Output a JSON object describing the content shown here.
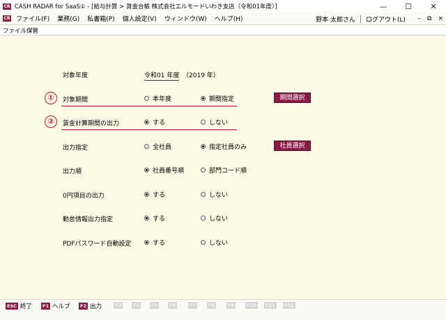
{
  "window": {
    "logo_text": "CR",
    "title": "CASH RADAR for SaaS① - [給与計算 > 賃金台帳 株式会社エルモードいわき支店（令和01年度）]",
    "controls": {
      "minimize": "—",
      "maximize": "☐",
      "close": "✕"
    }
  },
  "menubar": {
    "logo_text": "CR",
    "items": [
      "ファイル(F)",
      "業務(G)",
      "私書箱(P)",
      "個人設定(V)",
      "ウィンドウ(W)",
      "ヘルプ(H)"
    ],
    "user": "野本 太郎さん",
    "logout": "ログアウト(L)",
    "mdi": {
      "minimize": "–",
      "restore": "⧉",
      "close": "×"
    }
  },
  "page": {
    "title": "ファイル保管"
  },
  "form": {
    "target_year": {
      "label": "対象年度",
      "value": "令和01 年度",
      "paren": "（2019 年）"
    },
    "target_period": {
      "marker": "①",
      "label": "対象期間",
      "opt1": "本年度",
      "opt2": "期間指定",
      "selected": 2,
      "button": "期間選択"
    },
    "wage_period": {
      "marker": "②",
      "label": "賃金計算期間の出力",
      "opt1": "する",
      "opt2": "しない",
      "selected": 1
    },
    "output_target": {
      "label": "出力指定",
      "opt1": "全社員",
      "opt2": "指定社員のみ",
      "selected": 2,
      "button": "社員選択"
    },
    "output_order": {
      "label": "出力順",
      "opt1": "社員番号順",
      "opt2": "部門コード順",
      "selected": 1
    },
    "zero_items": {
      "label": "0円項目の出力",
      "opt1": "する",
      "opt2": "しない",
      "selected": 1
    },
    "attendance": {
      "label": "勤怠情報出力指定",
      "opt1": "する",
      "opt2": "しない",
      "selected": 1
    },
    "pdf_password": {
      "label": "PDFパスワード自動設定",
      "opt1": "する",
      "opt2": "しない",
      "selected": 1
    }
  },
  "fkeys": [
    {
      "key": "ESC",
      "label": "終了",
      "active": true
    },
    {
      "key": "F1",
      "label": "ヘルプ",
      "active": true
    },
    {
      "key": "F2",
      "label": "出力",
      "active": true
    },
    {
      "key": "F3",
      "label": "",
      "active": false
    },
    {
      "key": "F4",
      "label": "",
      "active": false
    },
    {
      "key": "F5",
      "label": "",
      "active": false
    },
    {
      "key": "F6",
      "label": "",
      "active": false
    },
    {
      "key": "F7",
      "label": "",
      "active": false
    },
    {
      "key": "F8",
      "label": "",
      "active": false
    },
    {
      "key": "F9",
      "label": "",
      "active": false
    },
    {
      "key": "F10",
      "label": "",
      "active": false
    },
    {
      "key": "F11",
      "label": "",
      "active": false
    },
    {
      "key": "F12",
      "label": "",
      "active": false
    }
  ],
  "colors": {
    "accent": "#8b1a44",
    "marker": "#c8102e",
    "background": "#fdfbe6"
  }
}
